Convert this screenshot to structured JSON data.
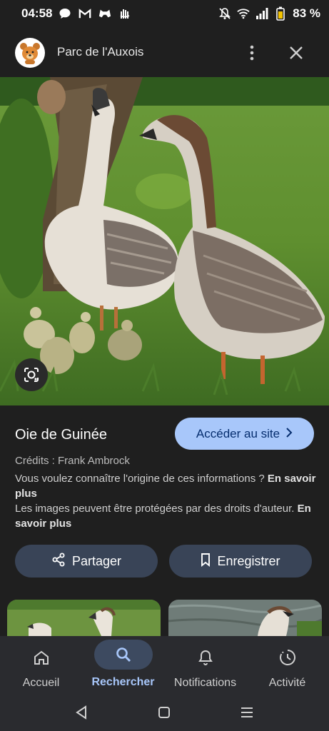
{
  "status_bar": {
    "time": "04:58",
    "battery_percent": "83 %",
    "left_icons": [
      "chat-bubble-icon",
      "gmail-icon",
      "game-controller-icon",
      "hand-sign-icon"
    ],
    "right_icons": [
      "mute-icon",
      "wifi-icon",
      "signal-icon",
      "battery-icon"
    ]
  },
  "header": {
    "title": "Parc de l'Auxois",
    "avatar_icon": "bear-logo-icon",
    "menu_icon": "more-vert-icon",
    "close_icon": "close-icon"
  },
  "image": {
    "description_icon": "google-lens-icon"
  },
  "details": {
    "title": "Oie de Guinée",
    "visit_button": "Accéder au site",
    "credits": "Crédits : Frank Ambrock",
    "origin_text": "Vous voulez connaître l'origine de ces informations ?",
    "origin_link": "En savoir plus",
    "copyright_text": "Les images peuvent être protégées par des droits d'auteur.",
    "copyright_link": "En savoir plus",
    "share_button": "Partager",
    "save_button": "Enregistrer"
  },
  "bottom_nav": {
    "items": [
      {
        "label": "Accueil",
        "icon": "home-icon",
        "active": false
      },
      {
        "label": "Rechercher",
        "icon": "search-icon",
        "active": true
      },
      {
        "label": "Notifications",
        "icon": "bell-icon",
        "active": false
      },
      {
        "label": "Activité",
        "icon": "activity-icon",
        "active": false
      }
    ]
  },
  "system_nav": [
    "back-icon",
    "home-button-icon",
    "recents-icon"
  ],
  "colors": {
    "background": "#1f1f1f",
    "accent": "#a8c7fa",
    "button_secondary": "#394457",
    "nav_background": "#2a2b2f"
  }
}
